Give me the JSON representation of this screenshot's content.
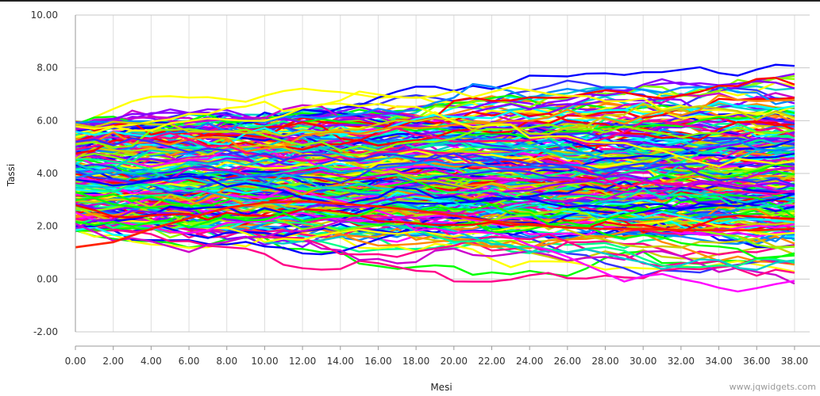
{
  "chart_data": {
    "type": "line",
    "title": "",
    "xlabel": "Mesi",
    "ylabel": "Tassi",
    "xlim": [
      0,
      38.8
    ],
    "ylim": [
      -2,
      10
    ],
    "x_ticks": [
      "0.00",
      "2.00",
      "4.00",
      "6.00",
      "8.00",
      "10.00",
      "12.00",
      "14.00",
      "16.00",
      "18.00",
      "20.00",
      "22.00",
      "24.00",
      "26.00",
      "28.00",
      "30.00",
      "32.00",
      "34.00",
      "36.00",
      "38.00"
    ],
    "y_ticks": [
      "-2.00",
      "0.00",
      "2.00",
      "4.00",
      "6.00",
      "8.00",
      "10.00"
    ],
    "grid": true,
    "legend": "none",
    "series_count": 260,
    "x_step": 1,
    "highlight_series": {
      "name": "",
      "color": "#ff2200",
      "x": [
        0,
        2,
        4,
        6,
        8,
        10,
        12,
        14,
        16,
        18,
        20,
        22,
        24,
        26,
        28,
        30,
        32,
        34,
        36,
        38
      ],
      "values": [
        1.2,
        1.4,
        1.9,
        2.3,
        2.7,
        2.9,
        2.95,
        2.85,
        2.75,
        2.6,
        2.4,
        2.2,
        2.05,
        1.95,
        1.9,
        1.9,
        1.85,
        1.85,
        1.85,
        1.9
      ]
    },
    "palette": [
      "#ff0000",
      "#00ff00",
      "#0000ff",
      "#ffff00",
      "#00ffff",
      "#ff00ff",
      "#ff8800",
      "#8800ff",
      "#00ff88",
      "#ff0088",
      "#0088ff",
      "#88ff00",
      "#cc00cc",
      "#00cccc",
      "#cccc00",
      "#3333ff"
    ]
  },
  "watermark": "www.jqwidgets.com"
}
